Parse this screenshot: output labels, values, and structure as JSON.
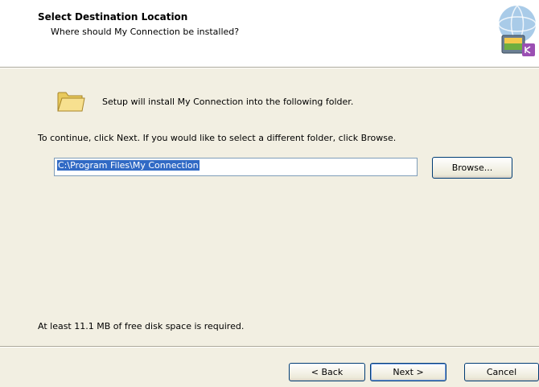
{
  "header": {
    "title": "Select Destination Location",
    "subtitle": "Where should My Connection be installed?",
    "image_icon": "wizard-monitor-globe-image"
  },
  "body": {
    "folder_icon": "folder-icon",
    "setup_text": "Setup will install My Connection into the following folder.",
    "continue_text": "To continue, click Next. If you would like to select a different folder, click Browse.",
    "path_value": "C:\\Program Files\\My Connection",
    "browse_label": "Browse...",
    "disk_space_text": "At least 11.1 MB of free disk space is required."
  },
  "footer": {
    "back_label": "< Back",
    "next_label": "Next >",
    "cancel_label": "Cancel"
  },
  "colors": {
    "panel_bg": "#f2efe2",
    "selection": "#316ac5",
    "button_border": "#003c74"
  }
}
